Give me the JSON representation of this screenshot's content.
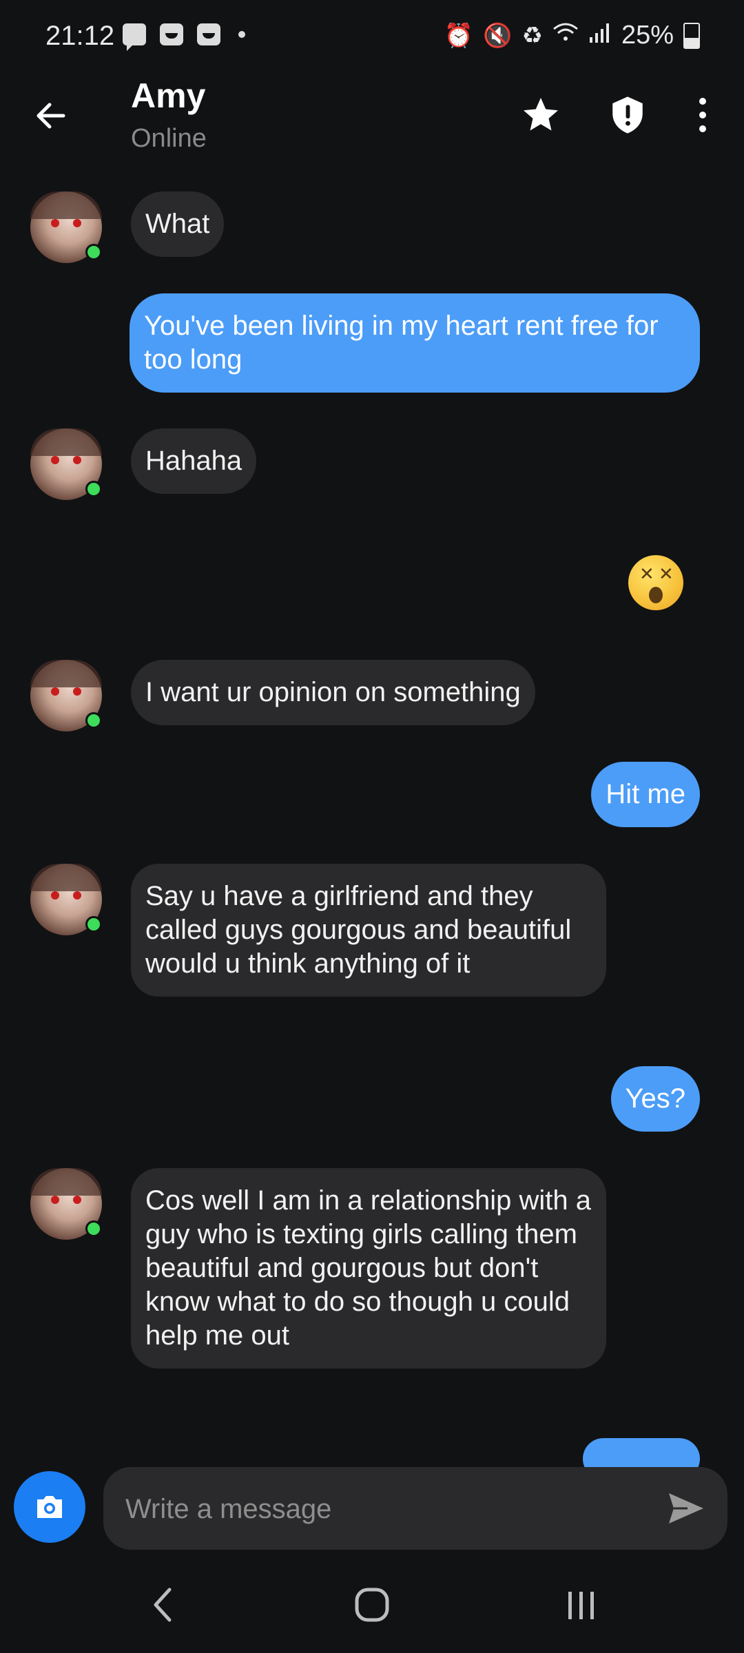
{
  "status_bar": {
    "time": "21:12",
    "battery": "25%",
    "icons": [
      "message-notification-icon",
      "app-notification-icon",
      "app-notification-icon",
      "dot-icon",
      "alarm-icon",
      "mute-icon",
      "battery-saver-icon",
      "wifi-icon",
      "signal-icon",
      "battery-icon"
    ]
  },
  "header": {
    "contact_name": "Amy",
    "contact_status": "Online",
    "actions": [
      "star-icon",
      "shield-icon",
      "more-vertical-icon"
    ]
  },
  "messages": [
    {
      "direction": "in",
      "text": "What"
    },
    {
      "direction": "out",
      "text": "You've been living in my heart rent free for too long"
    },
    {
      "direction": "in",
      "text": "Hahaha"
    },
    {
      "direction": "out",
      "emoji": "dizzy-face-emoji"
    },
    {
      "direction": "in",
      "text": "I want ur opinion on something"
    },
    {
      "direction": "out",
      "text": "Hit me"
    },
    {
      "direction": "in",
      "text": "Say u have a girlfriend and they called guys gourgous and beautiful would u think anything of it"
    },
    {
      "direction": "out",
      "text": "Yes?"
    },
    {
      "direction": "in",
      "text": "Cos well I am in a relationship with a guy who is texting girls calling them beautiful and gourgous but don't know what to do so though u could help me out"
    }
  ],
  "composer": {
    "placeholder": "Write a message"
  },
  "colors": {
    "background": "#111214",
    "incoming_bubble": "#2a2a2c",
    "outgoing_bubble": "#4c9df7",
    "camera_button": "#1b7ef2",
    "online_dot": "#3ddc5a"
  }
}
